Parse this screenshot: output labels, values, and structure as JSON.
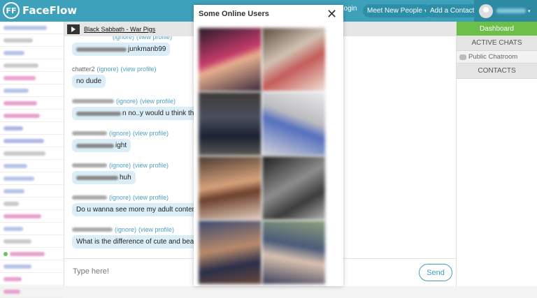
{
  "app": {
    "logo_mark": "FF",
    "logo_text": "FaceFlow"
  },
  "nav": {
    "login": "Login",
    "meet": "Meet New People",
    "add_contact": "Add a Contact",
    "caret": "▾"
  },
  "music": {
    "track": "Black Sabbath - War Pigs"
  },
  "chat": {
    "messages": [
      {
        "user": "",
        "ignore": "(ignore)",
        "view": "(view profile)",
        "text": "junkmanb99",
        "blurPrefix": true
      },
      {
        "user": "chatter2",
        "ignore": "(ignore)",
        "view": "(view profile)",
        "text": "no dude",
        "blurPrefix": false
      },
      {
        "user": "",
        "ignore": "(ignore)",
        "view": "(view profile)",
        "text": "n no..y would u think that",
        "blurPrefix": true
      },
      {
        "user": "",
        "ignore": "(ignore)",
        "view": "(view profile)",
        "text": "ight",
        "blurPrefix": true
      },
      {
        "user": "",
        "ignore": "(ignore)",
        "view": "(view profile)",
        "text": "huh",
        "blurPrefix": true
      },
      {
        "user": "",
        "ignore": "(ignore)",
        "view": "(view profile)",
        "text": "Do u wanna see more my adult content?",
        "blurPrefix": false
      },
      {
        "user": "",
        "ignore": "(ignore)",
        "view": "(view profile)",
        "text": "What is the difference of cute and beaut",
        "blurPrefix": false
      }
    ],
    "input_placeholder": "Type here!",
    "send_label": "Send"
  },
  "right": {
    "dashboard": "Dashboard",
    "active_chats": "ACTIVE CHATS",
    "public_chatroom": "Public Chatroom",
    "contacts": "CONTACTS"
  },
  "modal": {
    "title": "Some Online Users",
    "close": "✕"
  },
  "colors": {
    "brand": "#3ea1bb",
    "dashboard": "#6cc04a",
    "bubble": "#dbeef8",
    "sidebar_blur": [
      "#b6c4e8",
      "#c9c9c9",
      "#e7a1cd",
      "#b0b7e6",
      "#d9d9d9"
    ]
  },
  "icons": [
    "play-icon",
    "close-icon",
    "chat-bubble-icon",
    "avatar-icon",
    "chevron-down-icon"
  ]
}
